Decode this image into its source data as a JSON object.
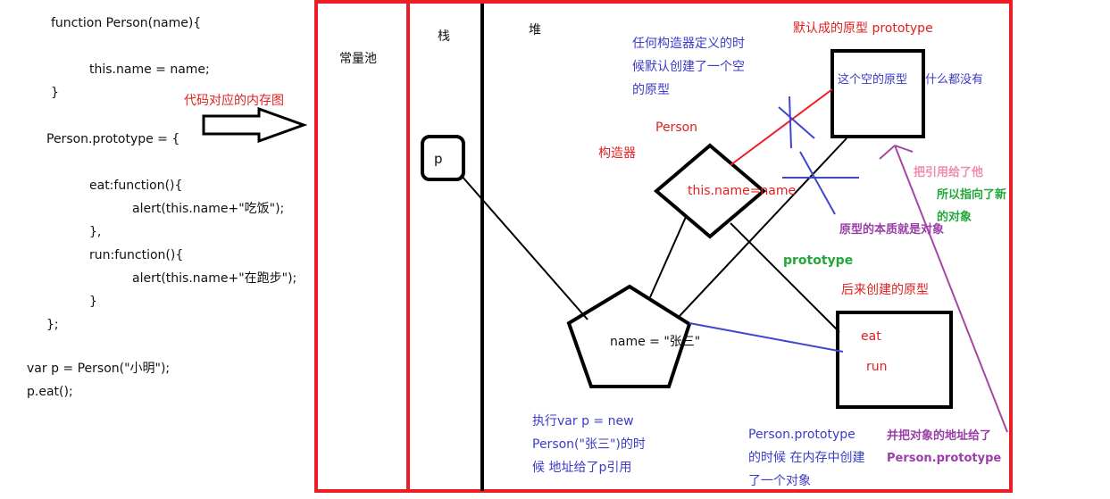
{
  "code": {
    "lines": [
      "function Person(name){",
      "this.name = name;",
      "}",
      "Person.prototype = {",
      "eat:function(){",
      "alert(this.name+\"吃饭\");",
      "},",
      "run:function(){",
      "alert(this.name+\"在跑步\");",
      "}",
      "};",
      "var p = Person(\"小明\");",
      "p.eat();"
    ]
  },
  "arrow_label": "代码对应的内存图",
  "regions": {
    "constant_pool": "常量池",
    "stack": "栈",
    "heap": "堆"
  },
  "stack_var": "p",
  "constructor": {
    "name": "Person",
    "role": "构造器",
    "body": "this.name=name"
  },
  "instance": {
    "content": "name = \"张三\""
  },
  "default_proto": {
    "title": "默认成的原型 prototype",
    "content": [
      "这个空的原型",
      "什么都没有"
    ]
  },
  "new_proto": {
    "title": "后来创建的原型",
    "methods": [
      "eat",
      "run"
    ]
  },
  "notes": {
    "any_constructor": [
      "任何构造器定义的时",
      "候默认创建了一个空",
      "的原型"
    ],
    "prototype_link": "prototype",
    "proto_is_object": "原型的本质就是对象",
    "gave_reference": "把引用给了他",
    "points_new": [
      "所以指向了新",
      "的对象"
    ],
    "exec_note": [
      "执行var p = new",
      "Person(\"张三\")的时",
      "候 地址给了p引用"
    ],
    "create_note": [
      "Person.prototype",
      "的时候 在内存中创建",
      "了一个对象"
    ],
    "addr_note": [
      "并把对象的地址给了",
      "Person.prototype"
    ]
  },
  "colors": {
    "frame_red": "#ee1c25",
    "line_blue": "#3f48cc",
    "line_purple": "#a349a4",
    "line_black": "#000000"
  }
}
